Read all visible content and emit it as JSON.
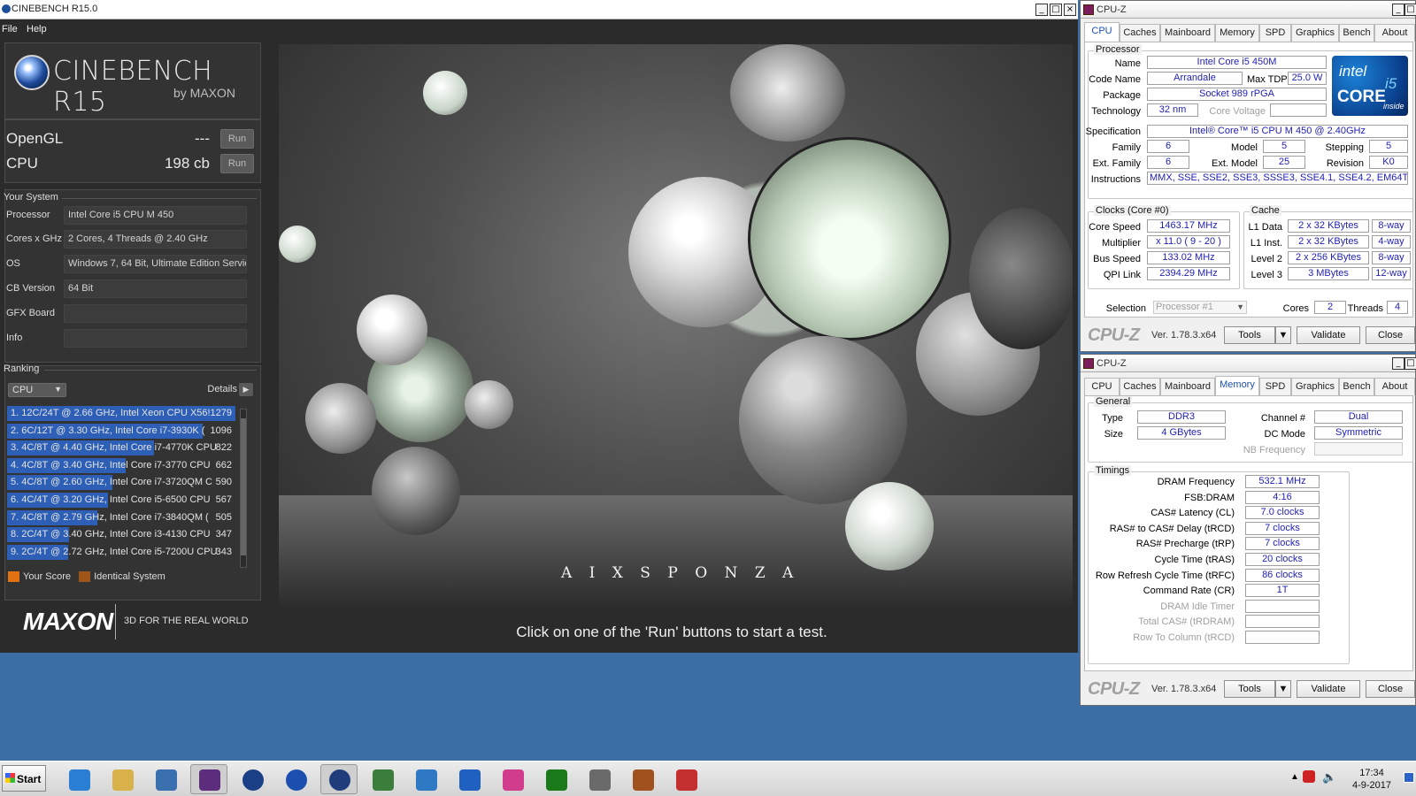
{
  "cinebench": {
    "title": "CINEBENCH R15.0",
    "menu": [
      "File",
      "Help"
    ],
    "logo": {
      "title": "CINEBENCH R15",
      "by": "by MAXON"
    },
    "tests": [
      {
        "label": "OpenGL",
        "score": "---",
        "run": "Run"
      },
      {
        "label": "CPU",
        "score": "198 cb",
        "run": "Run"
      }
    ],
    "system": {
      "title": "Your System",
      "rows": [
        {
          "k": "Processor",
          "v": "Intel Core i5 CPU M 450"
        },
        {
          "k": "Cores x GHz",
          "v": "2 Cores, 4 Threads @ 2.40 GHz"
        },
        {
          "k": "OS",
          "v": "Windows 7, 64 Bit, Ultimate Edition Service"
        },
        {
          "k": "CB Version",
          "v": "64 Bit"
        },
        {
          "k": "GFX Board",
          "v": ""
        },
        {
          "k": "Info",
          "v": ""
        }
      ]
    },
    "ranking": {
      "title": "Ranking",
      "dropdown": "CPU",
      "details": "Details",
      "rows": [
        {
          "text": "1. 12C/24T @ 2.66 GHz, Intel Xeon CPU X56!",
          "score": "1279",
          "fill": 1.0
        },
        {
          "text": "2. 6C/12T @ 3.30 GHz,  Intel Core i7-3930K (",
          "score": "1096",
          "fill": 0.857
        },
        {
          "text": "3. 4C/8T @ 4.40 GHz, Intel Core i7-4770K CPU",
          "score": "822",
          "fill": 0.643
        },
        {
          "text": "4. 4C/8T @ 3.40 GHz,  Intel Core i7-3770 CPU",
          "score": "662",
          "fill": 0.518
        },
        {
          "text": "5. 4C/8T @ 2.60 GHz, Intel Core i7-3720QM C",
          "score": "590",
          "fill": 0.461
        },
        {
          "text": "6. 4C/4T @ 3.20 GHz, Intel Core i5-6500 CPU",
          "score": "567",
          "fill": 0.443
        },
        {
          "text": "7. 4C/8T @ 2.79 GHz,  Intel Core i7-3840QM (",
          "score": "505",
          "fill": 0.395
        },
        {
          "text": "8. 2C/4T @ 3.40 GHz, Intel Core i3-4130 CPU",
          "score": "347",
          "fill": 0.271
        },
        {
          "text": "9. 2C/4T @ 2.72 GHz, Intel Core i5-7200U CPU",
          "score": "343",
          "fill": 0.268
        }
      ],
      "legend": [
        "Your Score",
        "Identical System"
      ]
    },
    "maxon": {
      "logo": "MAXON",
      "tagline": "3D FOR THE REAL WORLD"
    },
    "render_credit": "A I X S P O N Z A",
    "status": "Click on one of the 'Run' buttons to start a test."
  },
  "cpuz_top": {
    "title": "CPU-Z",
    "tabs": [
      "CPU",
      "Caches",
      "Mainboard",
      "Memory",
      "SPD",
      "Graphics",
      "Bench",
      "About"
    ],
    "active_tab": "CPU",
    "processor_group": "Processor",
    "name_label": "Name",
    "name": "Intel Core i5 450M",
    "codename_label": "Code Name",
    "codename": "Arrandale",
    "maxtdp_label": "Max TDP",
    "maxtdp": "25.0 W",
    "package_label": "Package",
    "package": "Socket 989 rPGA",
    "technology_label": "Technology",
    "technology": "32 nm",
    "corevoltage_label": "Core Voltage",
    "corevoltage": "",
    "specification_label": "Specification",
    "specification": "Intel® Core™ i5 CPU       M 450  @ 2.40GHz",
    "family_label": "Family",
    "family": "6",
    "model_label": "Model",
    "model": "5",
    "stepping_label": "Stepping",
    "stepping": "5",
    "extfamily_label": "Ext. Family",
    "extfamily": "6",
    "extmodel_label": "Ext. Model",
    "extmodel": "25",
    "revision_label": "Revision",
    "revision": "K0",
    "instructions_label": "Instructions",
    "instructions": "MMX, SSE, SSE2, SSE3, SSSE3, SSE4.1, SSE4.2, EM64T, VT-x",
    "intel_badge": {
      "brand": "intel",
      "line": "CORE",
      "model": "i5",
      "inside": "inside"
    },
    "clocks_group": "Clocks (Core #0)",
    "corespeed_label": "Core Speed",
    "corespeed": "1463.17 MHz",
    "multiplier_label": "Multiplier",
    "multiplier": "x 11.0 ( 9 - 20 )",
    "busspeed_label": "Bus Speed",
    "busspeed": "133.02 MHz",
    "qpilink_label": "QPI Link",
    "qpilink": "2394.29 MHz",
    "cache_group": "Cache",
    "l1data_label": "L1 Data",
    "l1data": "2 x 32 KBytes",
    "l1data_way": "8-way",
    "l1inst_label": "L1 Inst.",
    "l1inst": "2 x 32 KBytes",
    "l1inst_way": "4-way",
    "level2_label": "Level 2",
    "level2": "2 x 256 KBytes",
    "level2_way": "8-way",
    "level3_label": "Level 3",
    "level3": "3 MBytes",
    "level3_way": "12-way",
    "selection_label": "Selection",
    "selection": "Processor #1",
    "cores_label": "Cores",
    "cores": "2",
    "threads_label": "Threads",
    "threads": "4",
    "logo": "CPU-Z",
    "version": "Ver. 1.78.3.x64",
    "tools": "Tools",
    "validate": "Validate",
    "close": "Close"
  },
  "cpuz_bottom": {
    "title": "CPU-Z",
    "tabs": [
      "CPU",
      "Caches",
      "Mainboard",
      "Memory",
      "SPD",
      "Graphics",
      "Bench",
      "About"
    ],
    "active_tab": "Memory",
    "general_group": "General",
    "type_label": "Type",
    "type": "DDR3",
    "size_label": "Size",
    "size": "4 GBytes",
    "channel_label": "Channel #",
    "channel": "Dual",
    "dcmode_label": "DC Mode",
    "dcmode": "Symmetric",
    "nbfreq_label": "NB Frequency",
    "nbfreq": "",
    "timings_group": "Timings",
    "timings": [
      {
        "k": "DRAM Frequency",
        "v": "532.1 MHz",
        "dis": false
      },
      {
        "k": "FSB:DRAM",
        "v": "4:16",
        "dis": false
      },
      {
        "k": "CAS# Latency (CL)",
        "v": "7.0 clocks",
        "dis": false
      },
      {
        "k": "RAS# to CAS# Delay (tRCD)",
        "v": "7 clocks",
        "dis": false
      },
      {
        "k": "RAS# Precharge (tRP)",
        "v": "7 clocks",
        "dis": false
      },
      {
        "k": "Cycle Time (tRAS)",
        "v": "20 clocks",
        "dis": false
      },
      {
        "k": "Row Refresh Cycle Time (tRFC)",
        "v": "86 clocks",
        "dis": false
      },
      {
        "k": "Command Rate (CR)",
        "v": "1T",
        "dis": false
      },
      {
        "k": "DRAM Idle Timer",
        "v": "",
        "dis": true
      },
      {
        "k": "Total CAS# (tRDRAM)",
        "v": "",
        "dis": true
      },
      {
        "k": "Row To Column (tRCD)",
        "v": "",
        "dis": true
      }
    ],
    "logo": "CPU-Z",
    "version": "Ver. 1.78.3.x64",
    "tools": "Tools",
    "validate": "Validate",
    "close": "Close"
  },
  "taskbar": {
    "start": "Start",
    "apps": [
      "internet-explorer",
      "file-explorer",
      "remote-desktop",
      "cpu-z",
      "cinebench-r11",
      "blue-orb",
      "cinebench-r15",
      "monitor-graph",
      "network-bars",
      "bar-chart",
      "color-pick",
      "super-pi",
      "cat-app",
      "pi-app",
      "red-app"
    ],
    "time": "17:34",
    "date": "4-9-2017"
  }
}
